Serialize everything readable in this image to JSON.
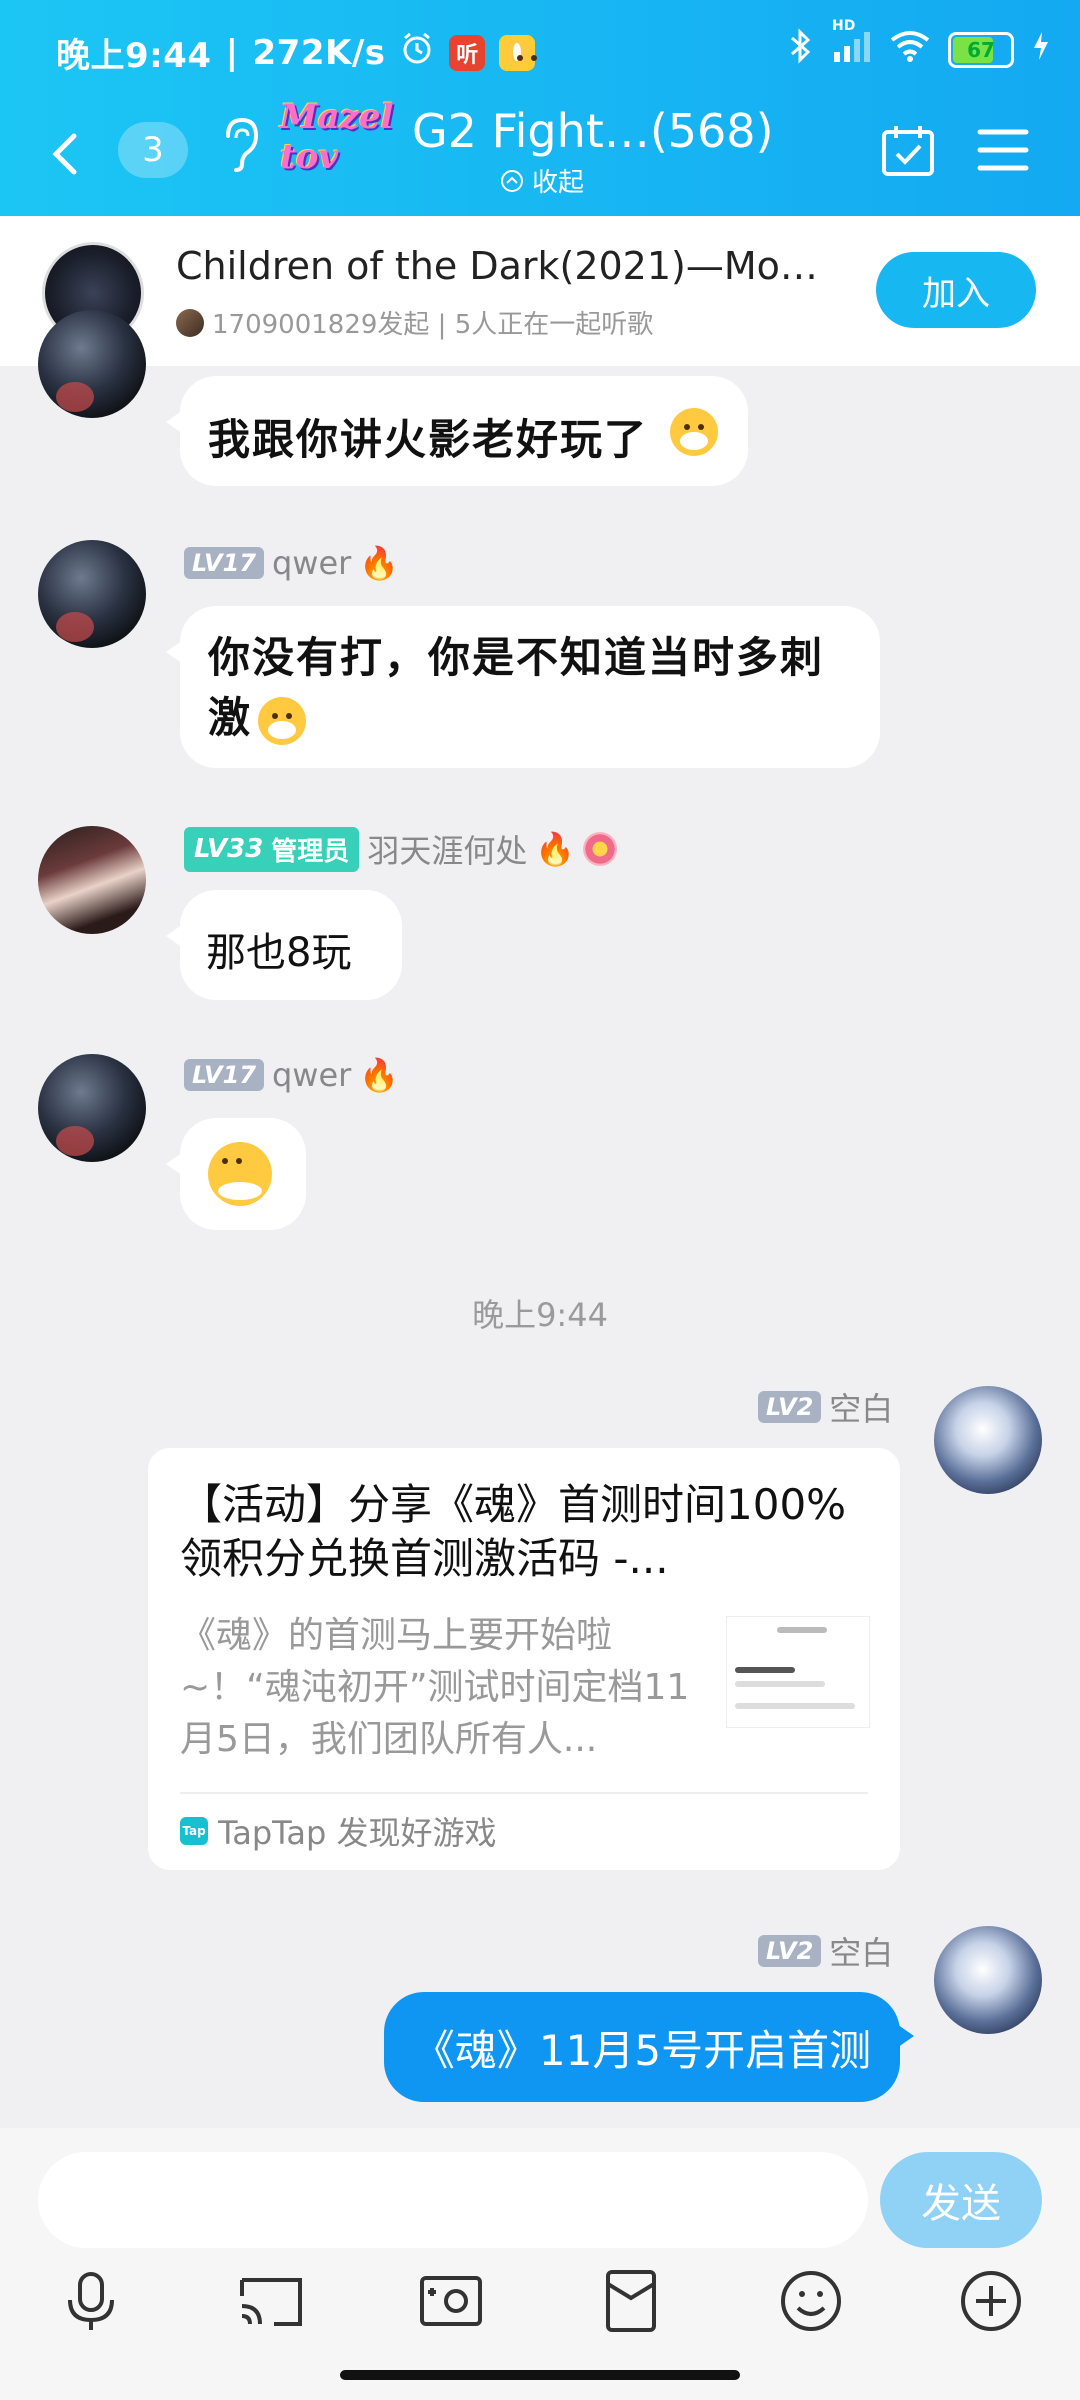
{
  "status_bar": {
    "time": "晚上9:44",
    "speed": "272K/s",
    "badge_listen": "听",
    "network": "HD",
    "battery": "67"
  },
  "header": {
    "unread_count": "3",
    "mazel_logo_text": "Mazel tov",
    "group_title": "G2 Fight…(568)",
    "collapse_label": "收起"
  },
  "music": {
    "title": "Children of the Dark(2021)—Mo…",
    "subtitle": "1709001829发起 | 5人正在一起听歌",
    "join_label": "加入"
  },
  "messages": [
    {
      "text": "我跟你讲火影老好玩了"
    },
    {
      "level": "LV17",
      "user": "qwer",
      "text": "你没有打，你是不知道当时多刺激"
    },
    {
      "level": "LV33",
      "role": "管理员",
      "user": "羽天涯何处",
      "text": "那也8玩"
    },
    {
      "level": "LV17",
      "user": "qwer"
    }
  ],
  "time_separator": "晚上9:44",
  "link_msg": {
    "level": "LV2",
    "user": "空白",
    "title": "【活动】分享《魂》首测时间100%领积分兑换首测激活码 -...",
    "desc": "《魂》的首测马上要开始啦~！“魂沌初开”测试时间定档11月5日，我们团队所有人...",
    "source": "TapTap 发现好游戏",
    "tap_logo": "Tap"
  },
  "my_msg": {
    "level": "LV2",
    "user": "空白",
    "text": "《魂》11月5号开启首测"
  },
  "input": {
    "send_label": "发送"
  },
  "colors": {
    "header_gradient_start": "#1cc6f4",
    "header_gradient_end": "#14a9f2",
    "accent": "#0e96f2",
    "admin_badge": "#38d0b8"
  }
}
